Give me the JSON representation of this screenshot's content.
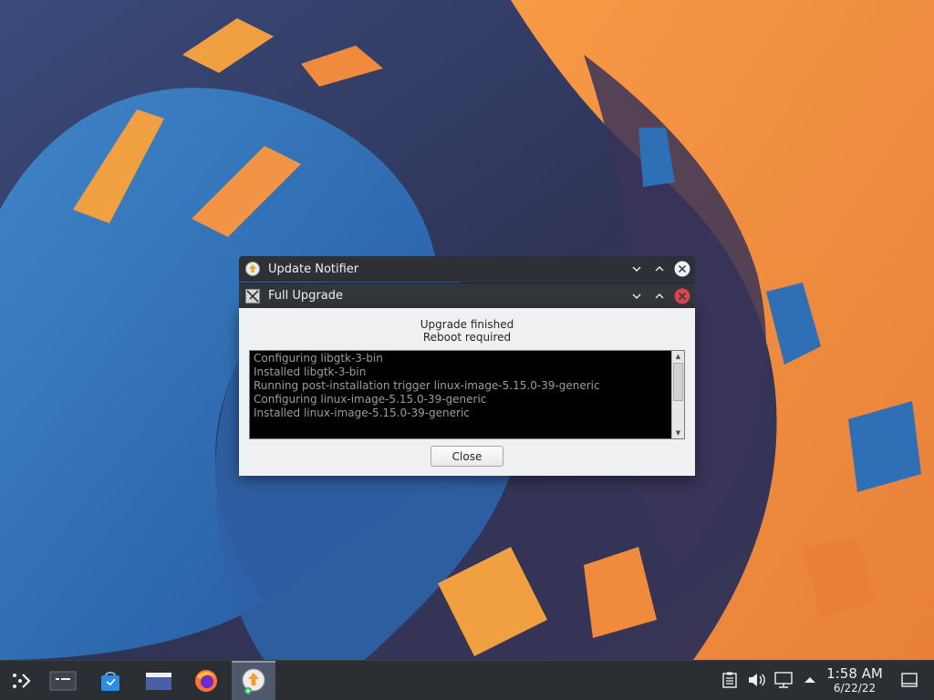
{
  "wallpaper": {
    "colors": {
      "blue": "#2f6fb6",
      "orange": "#f08a3c",
      "dark": "#2c2f4f"
    }
  },
  "windows": {
    "update_notifier": {
      "title": "Update Notifier",
      "icon": "update-notifier-icon"
    },
    "full_upgrade": {
      "title": "Full Upgrade",
      "icon": "x-window-icon"
    }
  },
  "dialog": {
    "status_line_1": "Upgrade finished",
    "status_line_2": "Reboot required",
    "log_lines": [
      "Configuring libgtk-3-bin",
      "Installed libgtk-3-bin",
      "Running post-installation trigger linux-image-5.15.0-39-generic",
      "Configuring linux-image-5.15.0-39-generic",
      "Installed linux-image-5.15.0-39-generic"
    ],
    "close_label": "Close"
  },
  "taskbar": {
    "launchers": [
      "application-launcher-icon",
      "pager-icon",
      "discover-store-icon",
      "file-manager-icon",
      "firefox-icon",
      "update-notifier-icon"
    ],
    "tray_icons": [
      "clipboard-icon",
      "volume-icon",
      "network-icon",
      "tray-expand-icon"
    ],
    "clock_time": "1:58 AM",
    "clock_date": "6/22/22"
  },
  "colors": {
    "titlebar": "#31363b",
    "close_active": "#da4453",
    "dialog_bg": "#eff0f1",
    "taskbar": "#2b2f33"
  }
}
